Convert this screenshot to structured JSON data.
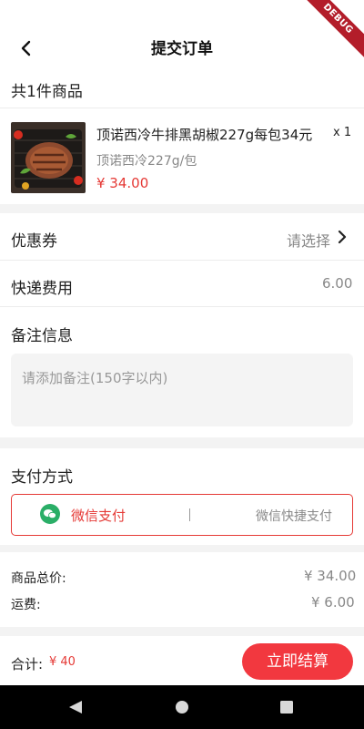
{
  "header": {
    "title": "提交订单",
    "debug_banner": "DEBUG"
  },
  "goods": {
    "count_label": "共1件商品",
    "item": {
      "name": "顶诺西冷牛排黑胡椒227g每包34元",
      "spec": "顶诺西冷227g/包",
      "price": "¥ 34.00",
      "quantity": "x 1"
    }
  },
  "coupon": {
    "label": "优惠券",
    "value": "请选择"
  },
  "shipping": {
    "label": "快递费用",
    "value": "6.00"
  },
  "remark": {
    "label": "备注信息",
    "placeholder": "请添加备注(150字以内)"
  },
  "payment": {
    "label": "支付方式",
    "options": [
      {
        "label": "微信支付",
        "selected": true
      },
      {
        "label": "微信快捷支付",
        "selected": false
      }
    ],
    "accent_color": "#e53935",
    "wechat_color": "#2aae67"
  },
  "summary": {
    "goods_total_label": "商品总价:",
    "goods_total_value": "¥ 34.00",
    "freight_label": "运费:",
    "freight_value": "¥ 6.00"
  },
  "footer": {
    "total_label": "合计:",
    "total_value": "¥ 40",
    "settle_label": "立即结算",
    "button_color": "#f2383f"
  },
  "system_nav": {
    "icons": [
      "back-triangle-icon",
      "home-circle-icon",
      "recents-square-icon"
    ]
  }
}
